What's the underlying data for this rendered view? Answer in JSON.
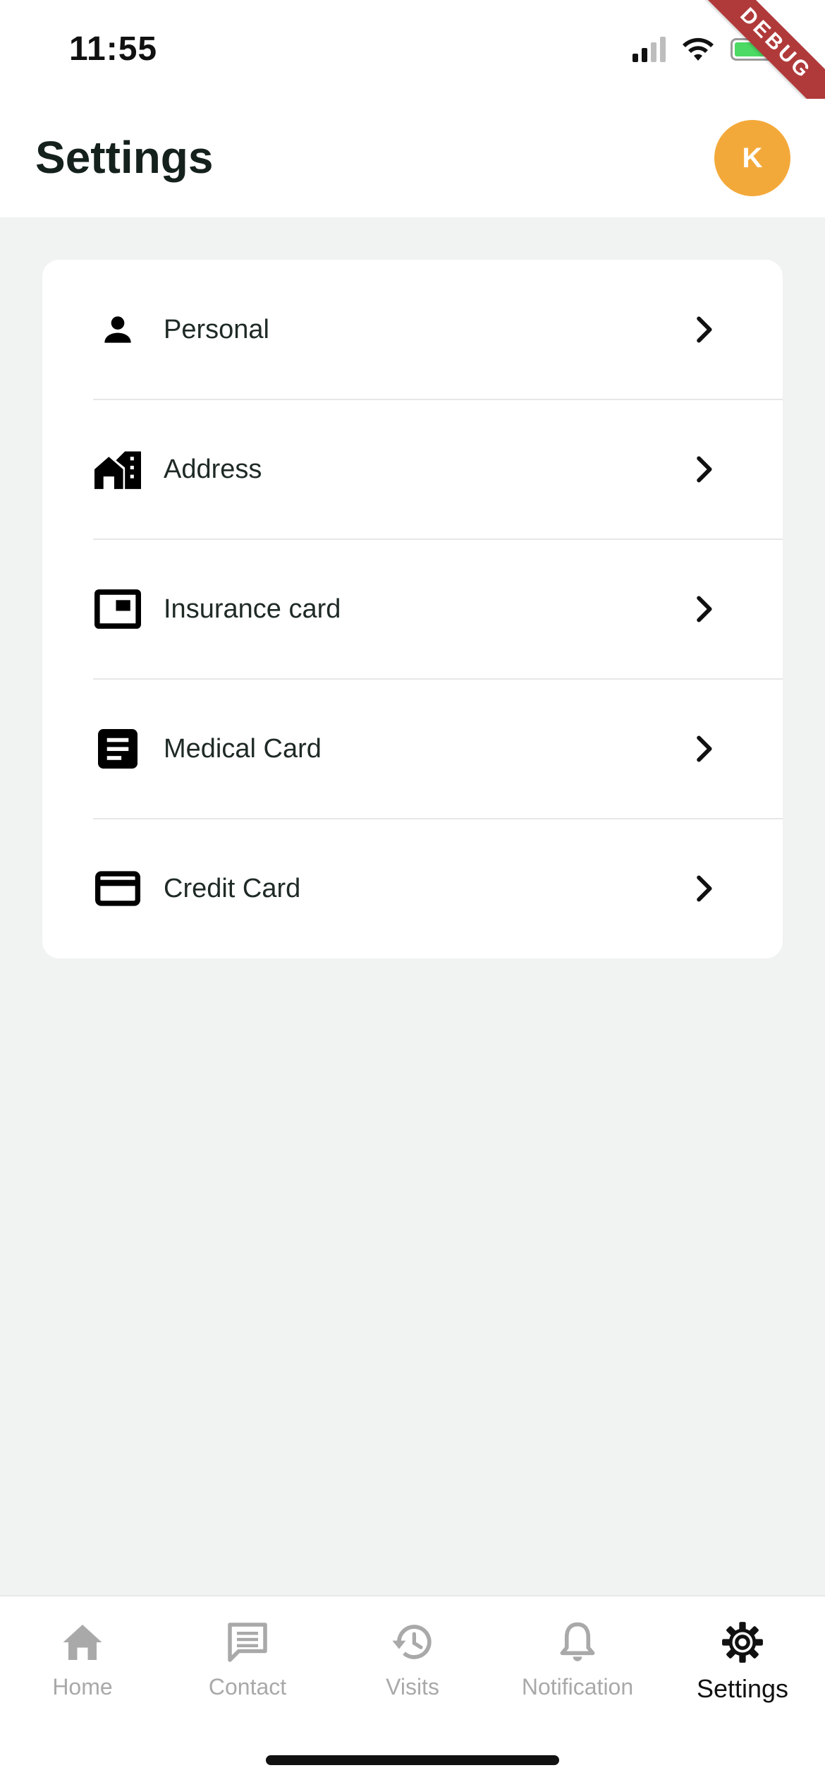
{
  "status_bar": {
    "time": "11:55",
    "debug_label": "DEBUG"
  },
  "header": {
    "title": "Settings",
    "avatar_initial": "K",
    "avatar_color": "#f3a93a"
  },
  "settings": {
    "items": [
      {
        "label": "Personal",
        "icon": "person-icon"
      },
      {
        "label": "Address",
        "icon": "home-work-icon"
      },
      {
        "label": "Insurance card",
        "icon": "picture-in-picture-icon"
      },
      {
        "label": "Medical Card",
        "icon": "article-icon"
      },
      {
        "label": "Credit Card",
        "icon": "credit-card-icon"
      }
    ]
  },
  "bottom_nav": {
    "items": [
      {
        "label": "Home",
        "icon": "home-icon",
        "active": false
      },
      {
        "label": "Contact",
        "icon": "chat-icon",
        "active": false
      },
      {
        "label": "Visits",
        "icon": "history-icon",
        "active": false
      },
      {
        "label": "Notification",
        "icon": "bell-icon",
        "active": false
      },
      {
        "label": "Settings",
        "icon": "gear-icon",
        "active": true
      }
    ],
    "active_color": "#111111",
    "inactive_color": "#a9a9a9"
  }
}
